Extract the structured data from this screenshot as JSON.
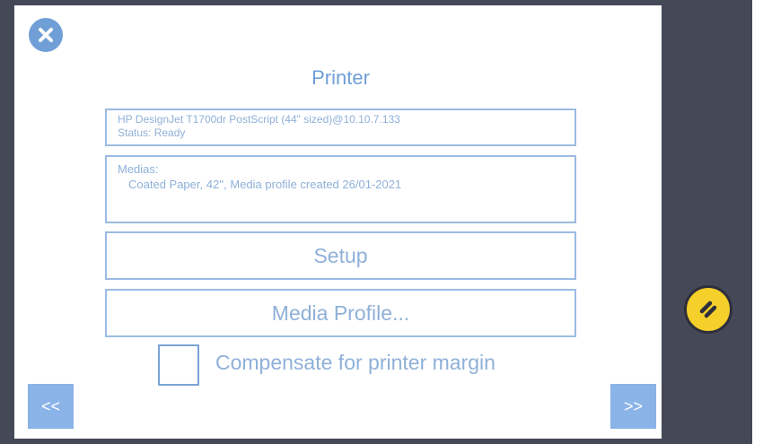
{
  "dialog": {
    "title": "Printer",
    "printer_info": {
      "name": "HP DesignJet T1700dr PostScript (44\" sized)@10.10.7.133",
      "status": "Status:   Ready"
    },
    "medias": {
      "label": "Medias:",
      "items": [
        "Coated Paper, 42'', Media profile created 26/01-2021"
      ]
    },
    "setup_label": "Setup",
    "media_profile_label": "Media Profile...",
    "compensate_label": "Compensate for printer margin",
    "compensate_checked": false
  },
  "nav": {
    "prev_label": "<<",
    "next_label": ">>"
  },
  "icons": {
    "close": "close-icon",
    "edit": "pencil-icon"
  },
  "colors": {
    "accent": "#6f9fd6",
    "nav_button": "#8ab3e8",
    "side_panel": "#454857",
    "edit_button": "#f5cf2a"
  }
}
